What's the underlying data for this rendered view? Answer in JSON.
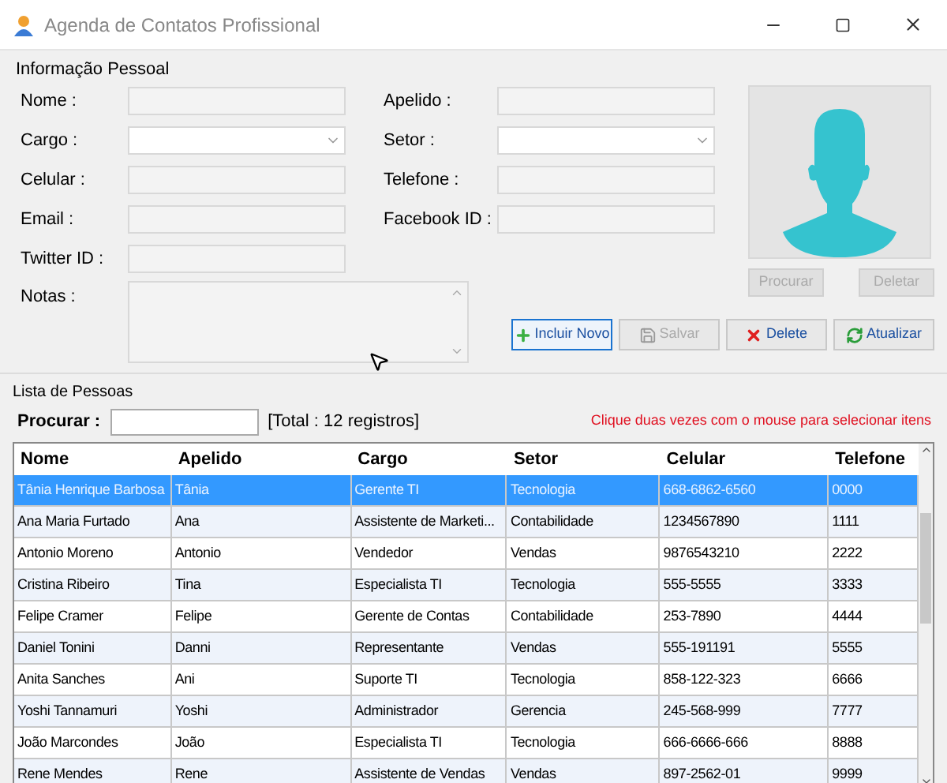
{
  "window": {
    "title": "Agenda de Contatos Profissional"
  },
  "personal": {
    "title": "Informação Pessoal",
    "fields": [
      {
        "label": "Nome :",
        "kind": "text"
      },
      {
        "label": "Apelido :",
        "kind": "text"
      },
      {
        "label": "Cargo :",
        "kind": "combo"
      },
      {
        "label": "Setor :",
        "kind": "combo"
      },
      {
        "label": "Celular :",
        "kind": "text"
      },
      {
        "label": "Telefone :",
        "kind": "text"
      },
      {
        "label": "Email :",
        "kind": "text"
      },
      {
        "label": "Facebook ID :",
        "kind": "text"
      },
      {
        "label": "Twitter ID :",
        "kind": "text"
      }
    ],
    "notes_label": "Notas :",
    "photo_buttons": [
      {
        "label": "Procurar",
        "disabled": true
      },
      {
        "label": "Deletar",
        "disabled": true
      }
    ],
    "actions": [
      {
        "label": "Incluir Novo",
        "disabled": false,
        "focused": true
      },
      {
        "label": "Salvar",
        "disabled": true,
        "focused": false
      },
      {
        "label": "Delete",
        "disabled": false,
        "focused": false
      },
      {
        "label": "Atualizar",
        "disabled": false,
        "focused": false
      }
    ]
  },
  "list": {
    "title": "Lista de Pessoas",
    "search_label": "Procurar :",
    "total": "[Total : 12 registros]",
    "hint": "Clique duas vezes com o mouse para selecionar itens",
    "columns": [
      "Nome",
      "Apelido",
      "Cargo",
      "Setor",
      "Celular",
      "Telefone"
    ],
    "rows": [
      {
        "cells": [
          "Tânia Henrique Barbosa",
          "Tânia",
          "Gerente TI",
          "Tecnologia",
          "668-6862-6560",
          "0000"
        ],
        "selected": true
      },
      {
        "cells": [
          "Ana Maria Furtado",
          "Ana",
          "Assistente de Marketi...",
          "Contabilidade",
          "1234567890",
          "1111"
        ],
        "selected": false
      },
      {
        "cells": [
          "Antonio Moreno",
          "Antonio",
          "Vendedor",
          "Vendas",
          "9876543210",
          "2222"
        ],
        "selected": false
      },
      {
        "cells": [
          "Cristina Ribeiro",
          "Tina",
          "Especialista TI",
          "Tecnologia",
          "555-5555",
          "3333"
        ],
        "selected": false
      },
      {
        "cells": [
          "Felipe Cramer",
          "Felipe",
          "Gerente de Contas",
          "Contabilidade",
          "253-7890",
          "4444"
        ],
        "selected": false
      },
      {
        "cells": [
          "Daniel Tonini",
          "Danni",
          "Representante",
          "Vendas",
          "555-191191",
          "5555"
        ],
        "selected": false
      },
      {
        "cells": [
          "Anita Sanches",
          "Ani",
          "Suporte TI",
          "Tecnologia",
          "858-122-323",
          "6666"
        ],
        "selected": false
      },
      {
        "cells": [
          "Yoshi Tannamuri",
          "Yoshi",
          "Administrador",
          "Gerencia",
          "245-568-999",
          "7777"
        ],
        "selected": false
      },
      {
        "cells": [
          "João Marcondes",
          "João",
          "Especialista TI",
          "Tecnologia",
          "666-6666-666",
          "8888"
        ],
        "selected": false
      },
      {
        "cells": [
          "Rene Mendes",
          "Rene",
          "Assistente de Vendas",
          "Vendas",
          "897-2562-01",
          "9999"
        ],
        "selected": false
      }
    ]
  }
}
